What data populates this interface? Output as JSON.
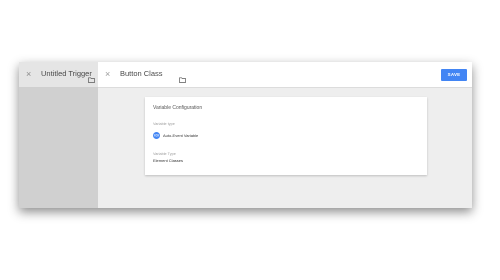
{
  "left_tab": {
    "close_glyph": "×",
    "title": "Untitled Trigger",
    "folder_icon": "folder-icon"
  },
  "editor": {
    "close_glyph": "×",
    "title": "Button Class",
    "folder_icon": "folder-icon",
    "save_label": "SAVE"
  },
  "config_card": {
    "heading": "Variable Configuration",
    "variable_label": "Variable type",
    "variable_chip": "{{}}",
    "variable_name": "Auto-Event Variable",
    "type_label": "Variable Type",
    "type_value": "Element Classes"
  },
  "colors": {
    "accent": "#4285f4",
    "left_panel": "#d0d0d0",
    "workspace": "#eeeeee"
  }
}
